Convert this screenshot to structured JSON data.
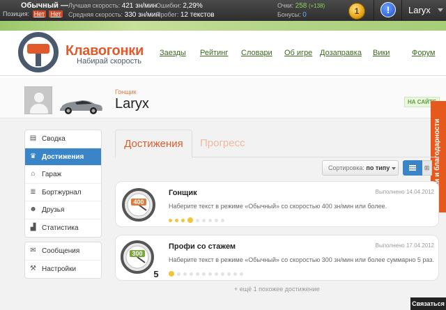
{
  "topbar": {
    "mode": "Обычный —",
    "position_label": "Позиция:",
    "position_answers": [
      "Нет",
      "Нет"
    ],
    "best_speed_label": "Лучшая скорость:",
    "best_speed_value": "421 зн/мин",
    "avg_speed_label": "Средняя скорость:",
    "avg_speed_value": "330 зн/мин",
    "errors_label": "Ошибки:",
    "errors_value": "2,29%",
    "mileage_label": "Пробег:",
    "mileage_value": "12 текстов",
    "points_label": "Очки:",
    "points_value": "258",
    "points_delta": "(+138)",
    "bonus_label": "Бонусы:",
    "bonus_value": "0",
    "level": "1",
    "alert": "!",
    "user": "Laryx"
  },
  "logo": {
    "title": "Клавогонки",
    "subtitle": "Набирай скорость"
  },
  "nav": [
    "Заезды",
    "Рейтинг",
    "Словари",
    "Об игре",
    "Дозаправка",
    "Вики",
    "Форум"
  ],
  "profile": {
    "role": "Гонщик",
    "name": "Laryx",
    "status": "НА САЙТЕ"
  },
  "side_tab": "Хотелки и благодарности",
  "menu_primary": [
    {
      "label": "Сводка",
      "icon": "summary-icon",
      "glyph": "▤"
    },
    {
      "label": "Достижения",
      "icon": "trophy-icon",
      "glyph": "♛"
    },
    {
      "label": "Гараж",
      "icon": "garage-icon",
      "glyph": "⌂"
    },
    {
      "label": "Бортжурнал",
      "icon": "journal-icon",
      "glyph": "≣"
    },
    {
      "label": "Друзья",
      "icon": "friends-icon",
      "glyph": "☻"
    },
    {
      "label": "Статистика",
      "icon": "stats-icon",
      "glyph": "▟"
    }
  ],
  "menu_secondary": [
    {
      "label": "Сообщения",
      "icon": "envelope-icon",
      "glyph": "✉"
    },
    {
      "label": "Настройки",
      "icon": "wrench-icon",
      "glyph": "⚒"
    }
  ],
  "tabs": {
    "active": "Достижения",
    "other": "Прогресс"
  },
  "sort": {
    "label": "Сортировка:",
    "value": "по типу"
  },
  "view_grid": "⊞",
  "achievements": [
    {
      "title": "Гонщик",
      "date": "Выполнено 14.04.2012",
      "desc": "Наберите текст в режиме «Обычный» со скоростью 400 зн/мин или более.",
      "badge_value": "400",
      "badge_count": "",
      "progress_done": 4,
      "progress_total": 9
    },
    {
      "title": "Профи со стажем",
      "date": "Выполнено 17.04.2012",
      "desc": "Наберите текст в режиме «Обычный» со скоростью 300 зн/мин или более суммарно 5 раз.",
      "badge_value": "300",
      "badge_count": "5",
      "progress_done": 1,
      "progress_total": 12
    }
  ],
  "more": "+ ещё 1 похожее достижение",
  "contact": "Связаться"
}
